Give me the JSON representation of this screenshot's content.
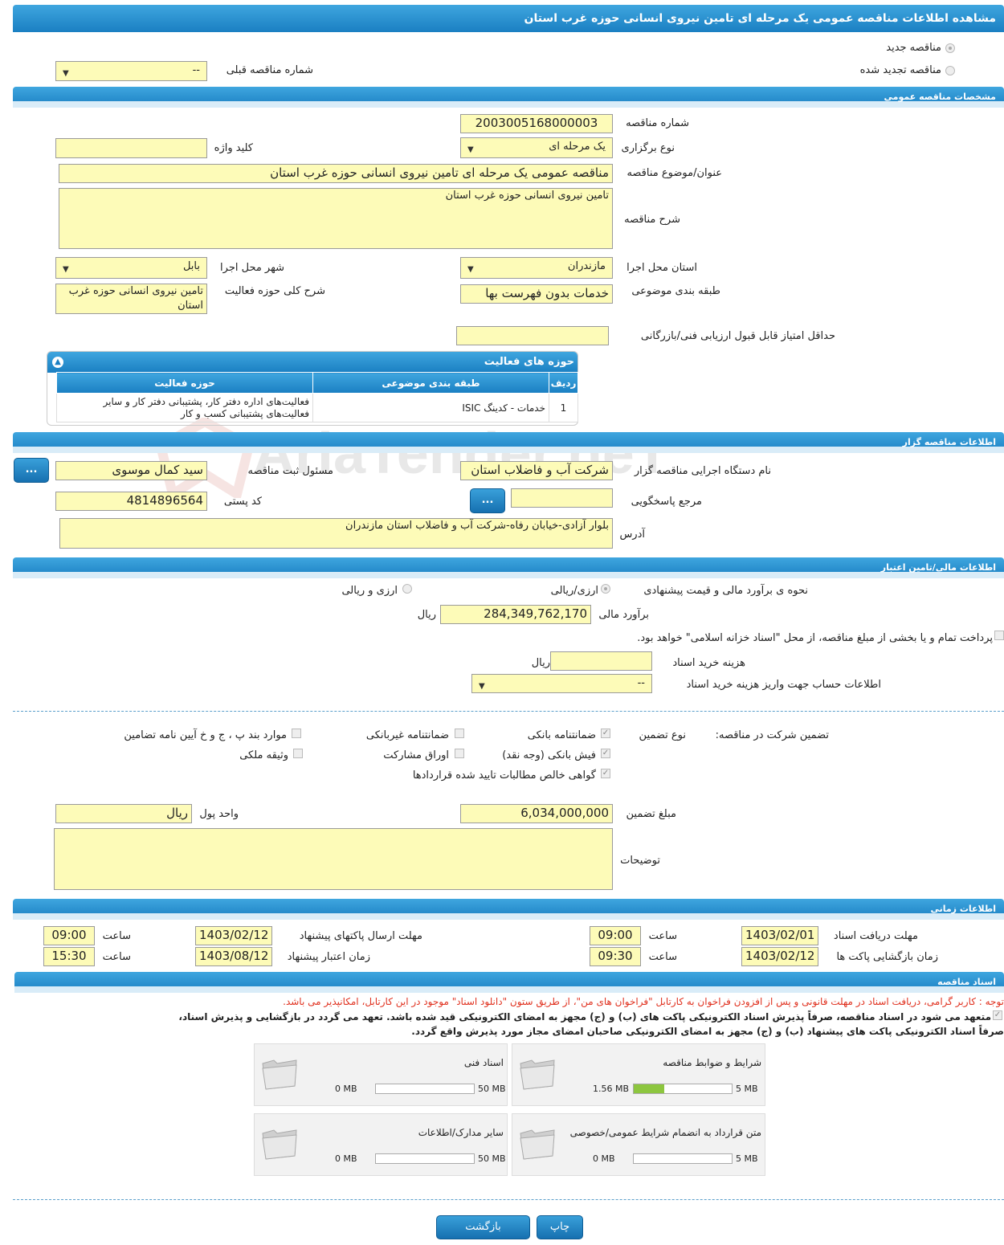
{
  "page_title": "مشاهده اطلاعات مناقصه عمومی یک مرحله ای تامین نیروی انسانی حوزه غرب استان",
  "watermark": "AriaTender.neT",
  "top": {
    "new_tender": "مناقصه جدید",
    "renewed_tender": "مناقصه تجدید شده",
    "prev_tender_label": "شماره مناقصه قبلی",
    "prev_tender_value": "--"
  },
  "general": {
    "header": "مشخصات مناقصه عمومی",
    "number_label": "شماره مناقصه",
    "number_value": "2003005168000003",
    "type_label": "نوع برگزاری",
    "type_value": "یک مرحله ای",
    "keyword_label": "کلید واژه",
    "keyword_value": "",
    "title_label": "عنوان/موضوع مناقصه",
    "title_value": "مناقصه عمومی یک مرحله ای تامین نیروی انسانی حوزه غرب استان",
    "desc_label": "شرح مناقصه",
    "desc_value": "تامین نیروی انسانی حوزه غرب استان",
    "province_label": "استان محل اجرا",
    "province_value": "مازندران",
    "city_label": "شهر محل اجرا",
    "city_value": "بابل",
    "category_label": "طبقه بندی موضوعی",
    "category_value": "خدمات بدون فهرست بها",
    "activity_desc_label": "شرح کلی حوزه فعالیت",
    "activity_desc_value": "تامین نیروی انسانی حوزه غرب استان",
    "min_score_label": "حداقل امتیاز قابل قبول ارزیابی فنی/بازرگانی",
    "min_score_value": ""
  },
  "activities": {
    "header": "حوزه های فعالیت",
    "columns": [
      "ردیف",
      "طبقه بندی موضوعی",
      "حوزه فعالیت"
    ],
    "rows": [
      {
        "idx": "1",
        "category": "خدمات - کدینگ ISIC",
        "field": "فعالیت‌های اداره دفتر کار، پشتیبانی دفتر کار و سایر فعالیت‌های پشتیبانی کسب و کار"
      }
    ]
  },
  "organizer": {
    "header": "اطلاعات مناقصه گزار",
    "org_label": "نام دستگاه اجرایی مناقصه گزار",
    "org_value": "شرکت آب و فاضلاب استان",
    "responsible_label": "مسئول ثبت مناقصه",
    "responsible_value": "سید کمال موسوی",
    "ref_label": "مرجع پاسخگویی",
    "ref_value": "",
    "postal_label": "کد پستی",
    "postal_value": "4814896564",
    "address_label": "آدرس",
    "address_value": "بلوار آزادی-خیابان رفاه-شرکت آب و فاضلاب استان مازندران",
    "more_btn": "..."
  },
  "finance": {
    "header": "اطلاعات مالی/تامین اعتبار",
    "method_label": "نحوه ی برآورد مالی و قیمت پیشنهادی",
    "opt_rial": "ارزی/ریالی",
    "opt_fx": "ارزی و ریالی",
    "estimate_label": "برآورد مالی",
    "estimate_value": "284,349,762,170",
    "rial": "ریال",
    "treasury_text": "پرداخت تمام و یا بخشی از مبلغ مناقصه، از محل \"اسناد خزانه اسلامی\" خواهد بود.",
    "doc_fee_label": "هزینه خرید اسناد",
    "doc_fee_value": "",
    "account_label": "اطلاعات حساب جهت واریز هزینه خرید اسناد",
    "account_value": "--"
  },
  "guarantee": {
    "section_label": "تضمین شرکت در مناقصه:",
    "type_label": "نوع تضمین",
    "options": {
      "bank_guarantee": "ضمانتنامه بانکی",
      "nonbank_guarantee": "ضمانتنامه غیربانکی",
      "clauses": "موارد بند پ ، ج و خ آیین نامه تضامین",
      "bank_receipt": "فیش بانکی (وجه نقد)",
      "bonds": "اوراق مشارکت",
      "property": "وثیقه ملکی",
      "certificate": "گواهی خالص مطالبات تایید شده قراردادها"
    },
    "amount_label": "مبلغ تضمین",
    "amount_value": "6,034,000,000",
    "currency_label": "واحد پول",
    "currency_value": "ریال",
    "notes_label": "توضیحات",
    "notes_value": ""
  },
  "timing": {
    "header": "اطلاعات زمانی",
    "receive_label": "مهلت دریافت اسناد",
    "receive_date": "1403/02/01",
    "receive_time": "09:00",
    "send_label": "مهلت ارسال پاکتهای پیشنهاد",
    "send_date": "1403/02/12",
    "send_time": "09:00",
    "open_label": "زمان بازگشایی پاکت ها",
    "open_date": "1403/02/12",
    "open_time": "09:30",
    "validity_label": "زمان اعتبار پیشنهاد",
    "validity_date": "1403/08/12",
    "validity_time": "15:30",
    "time_label": "ساعت"
  },
  "documents": {
    "header": "اسناد مناقصه",
    "notice": "توجه : کاربر گرامی، دریافت اسناد در مهلت قانونی و پس از افزودن فراخوان به کارتابل \"فراخوان های من\"، از طریق ستون \"دانلود اسناد\" موجود در این کارتابل، امکانپذیر می باشد.",
    "commit_line1": "متعهد می شود در اسناد مناقصه، صرفاً پذیرش اسناد الکترونیکی پاکت های (ب) و (ج) مجهز به امضای الکترونیکی قید شده باشد. تعهد می گردد در بازگشایی و پذیرش اسناد،",
    "commit_line2": "صرفاً اسناد الکترونیکی پاکت های پیشنهاد (ب) و (ج) مجهز به امضای الکترونیکی صاحبان امضای مجاز مورد پذیرش واقع گردد.",
    "cards": [
      {
        "title": "شرایط و ضوابط مناقصه",
        "used": "1.56 MB",
        "total": "5 MB",
        "fill": 0.31
      },
      {
        "title": "اسناد فنی",
        "used": "0 MB",
        "total": "50 MB",
        "fill": 0
      },
      {
        "title": "متن قرارداد به انضمام شرایط عمومی/خصوصی",
        "used": "0 MB",
        "total": "5 MB",
        "fill": 0
      },
      {
        "title": "سایر مدارک/اطلاعات",
        "used": "0 MB",
        "total": "50 MB",
        "fill": 0
      }
    ]
  },
  "footer": {
    "print": "چاپ",
    "back": "بازگشت"
  }
}
